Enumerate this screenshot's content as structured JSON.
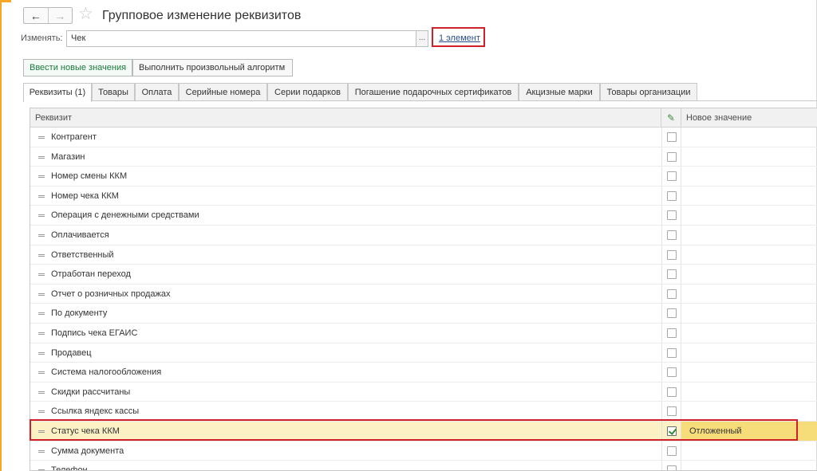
{
  "window": {
    "title": "Групповое изменение реквизитов",
    "nav_back": "←",
    "nav_forward": "→",
    "favorite_star": "☆"
  },
  "change": {
    "label": "Изменять:",
    "value": "Чек",
    "select_button": "...",
    "elements_link": "1 элемент"
  },
  "actions": {
    "enter_new_values": "Ввести новые значения",
    "run_algorithm": "Выполнить произвольный алгоритм"
  },
  "tabs": [
    {
      "label": "Реквизиты (1)",
      "active": true
    },
    {
      "label": "Товары",
      "active": false
    },
    {
      "label": "Оплата",
      "active": false
    },
    {
      "label": "Серийные номера",
      "active": false
    },
    {
      "label": "Серии подарков",
      "active": false
    },
    {
      "label": "Погашение подарочных сертификатов",
      "active": false
    },
    {
      "label": "Акцизные марки",
      "active": false
    },
    {
      "label": "Товары организации",
      "active": false
    }
  ],
  "table": {
    "columns": {
      "name": "Реквизит",
      "check_icon": "pencil-icon",
      "value": "Новое значение"
    },
    "rows": [
      {
        "name": "Контрагент",
        "checked": false,
        "value": ""
      },
      {
        "name": "Магазин",
        "checked": false,
        "value": ""
      },
      {
        "name": "Номер смены ККМ",
        "checked": false,
        "value": ""
      },
      {
        "name": "Номер чека ККМ",
        "checked": false,
        "value": ""
      },
      {
        "name": "Операция с денежными средствами",
        "checked": false,
        "value": ""
      },
      {
        "name": "Оплачивается",
        "checked": false,
        "value": ""
      },
      {
        "name": "Ответственный",
        "checked": false,
        "value": ""
      },
      {
        "name": "Отработан переход",
        "checked": false,
        "value": ""
      },
      {
        "name": "Отчет о розничных продажах",
        "checked": false,
        "value": ""
      },
      {
        "name": "По документу",
        "checked": false,
        "value": ""
      },
      {
        "name": "Подпись чека ЕГАИС",
        "checked": false,
        "value": ""
      },
      {
        "name": "Продавец",
        "checked": false,
        "value": ""
      },
      {
        "name": "Система налогообложения",
        "checked": false,
        "value": ""
      },
      {
        "name": "Скидки рассчитаны",
        "checked": false,
        "value": ""
      },
      {
        "name": "Ссылка яндекс кассы",
        "checked": false,
        "value": ""
      },
      {
        "name": "Статус чека ККМ",
        "checked": true,
        "value": "Отложенный",
        "selected": true
      },
      {
        "name": "Сумма документа",
        "checked": false,
        "value": ""
      },
      {
        "name": "Телефон",
        "checked": false,
        "value": ""
      }
    ]
  },
  "colors": {
    "accent_orange": "#f5a623",
    "highlight_red": "#d0212b",
    "selected_row": "#fbf1c4",
    "selected_value": "#f7dc7a",
    "link_blue": "#2b4f8f",
    "green_text": "#1a7a3f"
  }
}
